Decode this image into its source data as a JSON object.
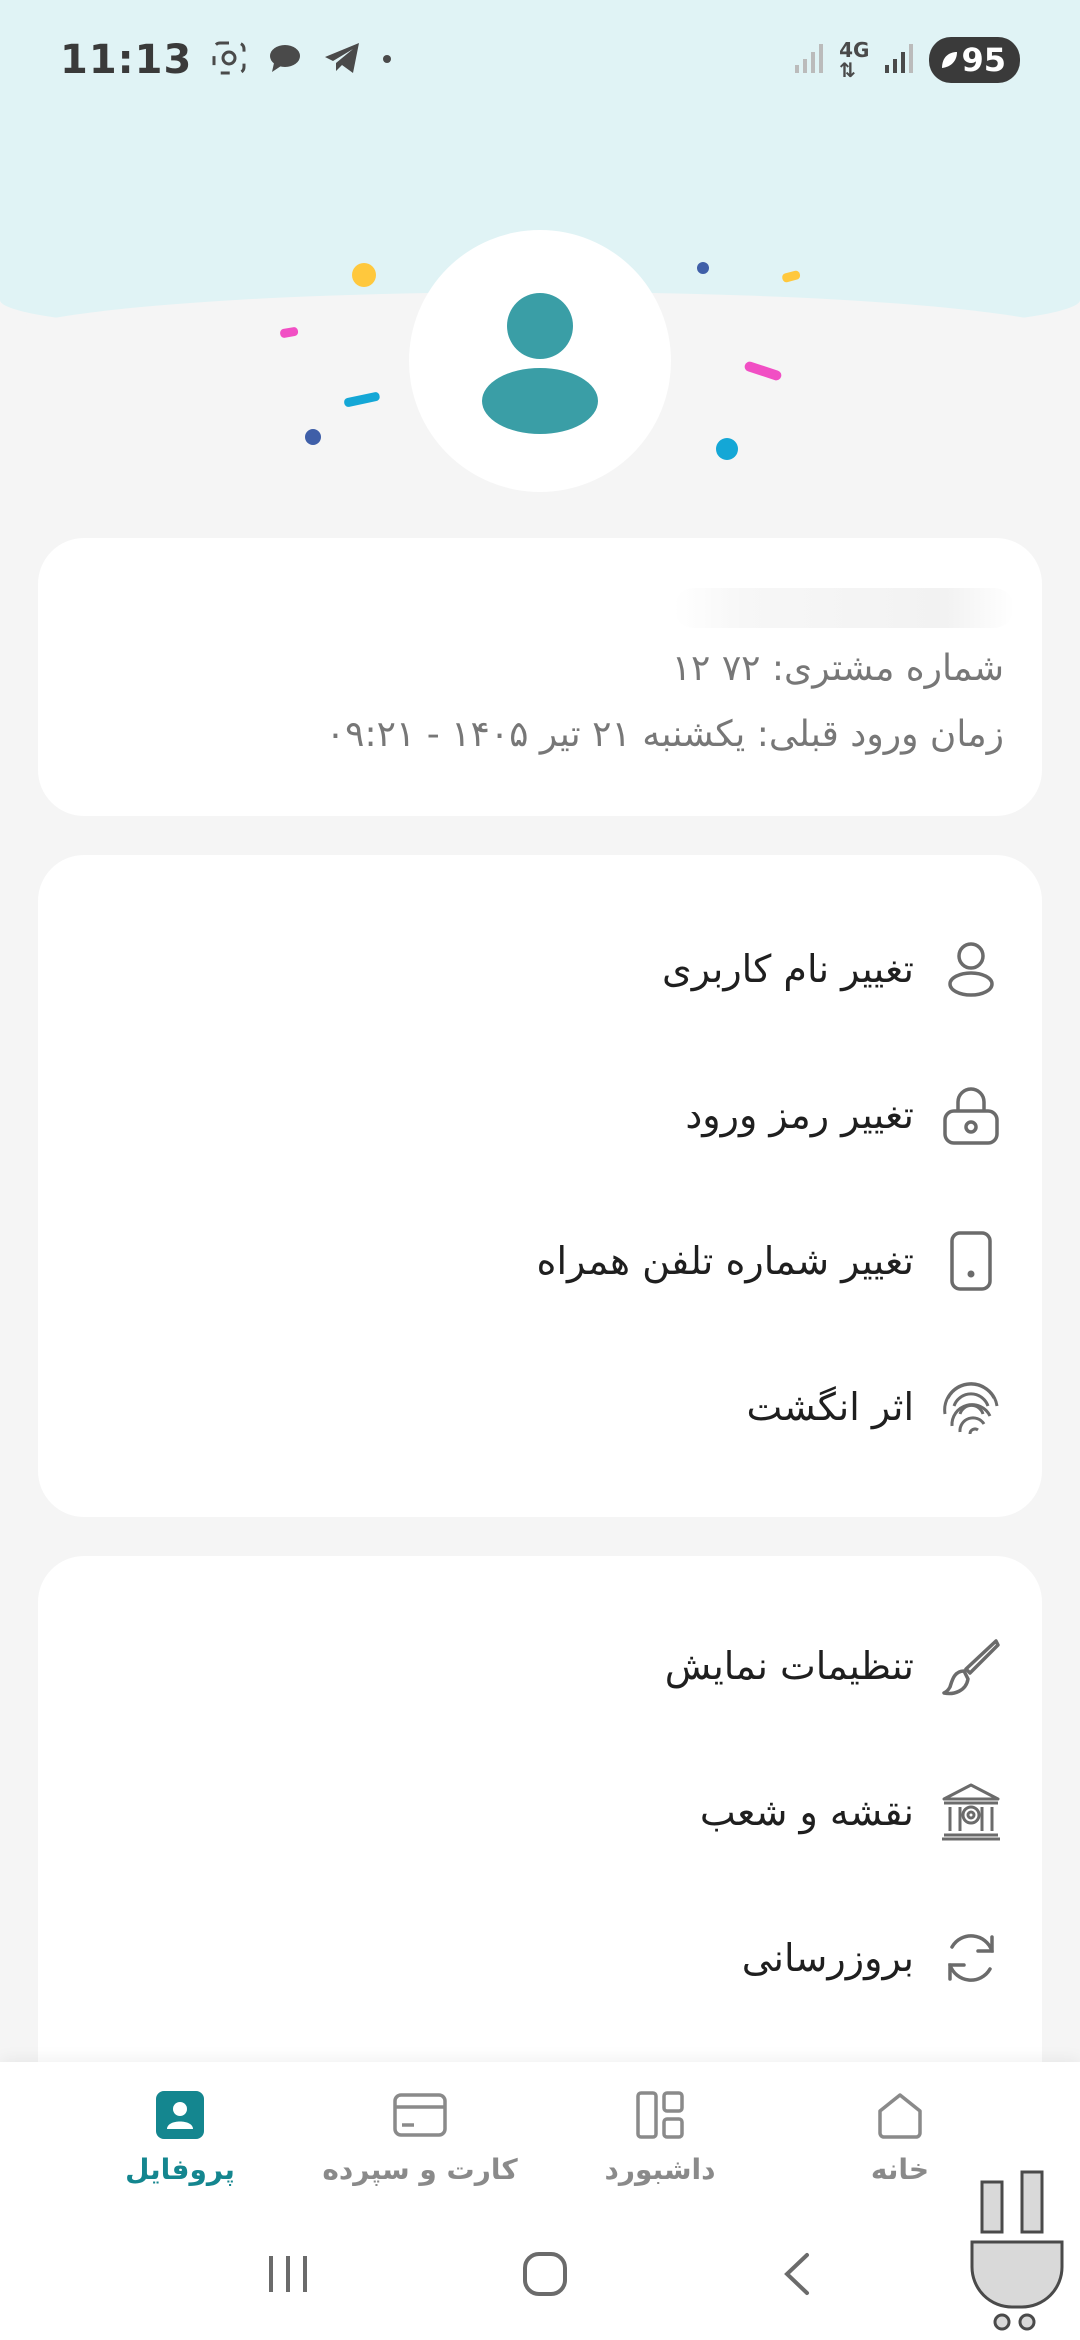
{
  "status_bar": {
    "time": "11:13",
    "network": "4G",
    "battery": "95"
  },
  "profile": {
    "customer_number": "شماره مشتری: ۷۲    ۱۲",
    "last_login": "زمان ورود قبلی: یکشنبه ۲۱ تیر ۱۴۰۵ - ۰۹:۲۱"
  },
  "account_menu": [
    {
      "label": "تغییر نام کاربری",
      "icon": "user-icon"
    },
    {
      "label": "تغییر رمز ورود",
      "icon": "lock-icon"
    },
    {
      "label": "تغییر شماره تلفن همراه",
      "icon": "mobile-phone-icon"
    },
    {
      "label": "اثر انگشت",
      "icon": "fingerprint-icon"
    }
  ],
  "general_menu": [
    {
      "label": "تنظیمات نمایش",
      "icon": "paintbrush-icon"
    },
    {
      "label": "نقشه و شعب",
      "icon": "bank-branch-icon"
    },
    {
      "label": "بروزرسانی",
      "icon": "refresh-icon"
    }
  ],
  "bottom_nav": [
    {
      "label": "خانه",
      "icon": "home-icon",
      "active": false
    },
    {
      "label": "داشبورد",
      "icon": "dashboard-icon",
      "active": false
    },
    {
      "label": "کارت و سپرده",
      "icon": "card-icon",
      "active": false
    },
    {
      "label": "پروفایل",
      "icon": "profile-icon",
      "active": true
    }
  ],
  "colors": {
    "accent": "#14868f",
    "avatar": "#3a9ea6",
    "header_bg": "#e0f3f5",
    "page_bg": "#f5f5f5"
  }
}
